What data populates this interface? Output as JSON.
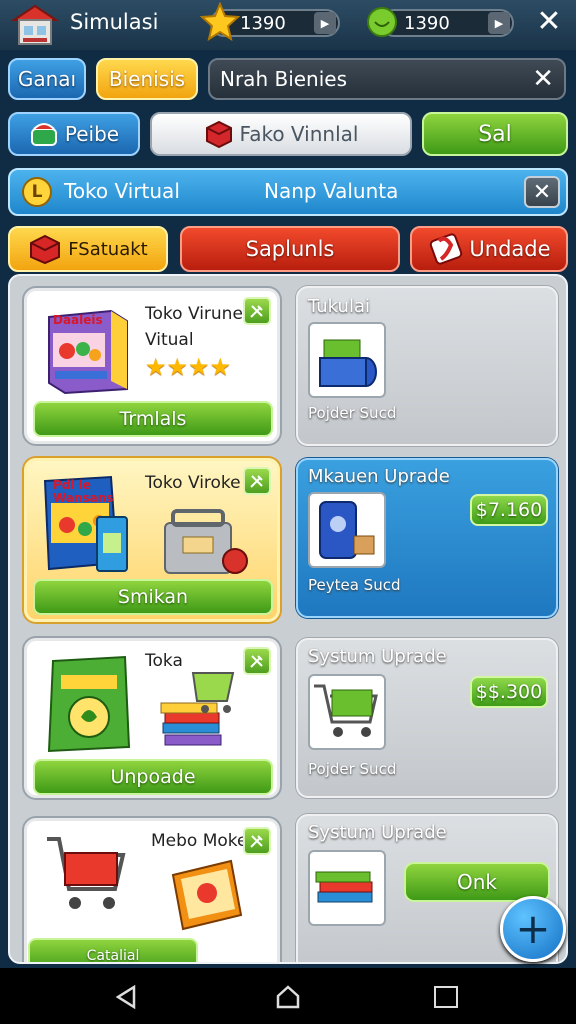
{
  "header": {
    "title": "Simulasi",
    "coins": "1390",
    "gems": "1390"
  },
  "tabs": {
    "tab1": "Ganaı",
    "tab2": "Bienisis",
    "search_value": "Nrah Bienies"
  },
  "row2": {
    "btn1": "Peibe",
    "btn2": "Fako Vinnlal",
    "btn3": "Sal"
  },
  "banner": {
    "icon_letter": "L",
    "left": "Toko Virtual",
    "right": "Nanp Valunta"
  },
  "categories": {
    "cat1": "FSatuakt",
    "cat2": "Saplunls",
    "cat3": "Undade"
  },
  "cards_left": [
    {
      "title": "Toko Virune\nVitual",
      "rating": 4,
      "button": "Trmlals",
      "box_text": "Daaleis"
    },
    {
      "title": "Toko Viroke",
      "button": "Smikan",
      "box_text": "Pdl le\nWansans"
    },
    {
      "title": "Toka",
      "button": "Unpoade"
    },
    {
      "title": "Mebo Moke",
      "button": "Catalial"
    }
  ],
  "cards_right": [
    {
      "title": "Tukulai",
      "sub": "Pojder Sucd"
    },
    {
      "title": "Mkauen Uprade",
      "sub": "Peytea Sucd",
      "price": "$7.160"
    },
    {
      "title": "Systum Uprade",
      "sub": "Pojder Sucd",
      "price": "$$.300"
    },
    {
      "title": "Systum Uprade",
      "button": "Onk"
    }
  ],
  "colors": {
    "accent_green": "#5bb428",
    "accent_blue": "#2a8fd6",
    "accent_red": "#e23a1f",
    "accent_yellow": "#f6c12a"
  }
}
